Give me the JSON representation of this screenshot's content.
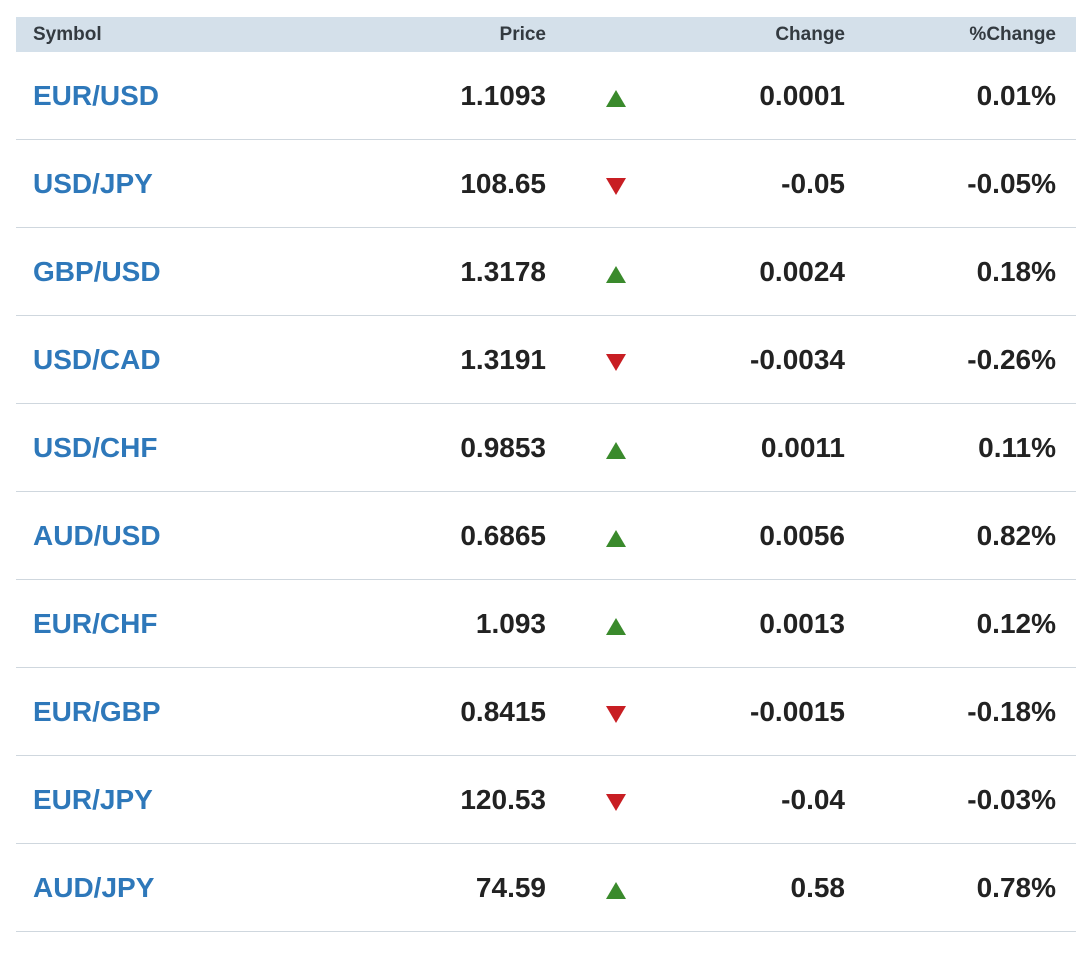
{
  "columns": {
    "symbol": "Symbol",
    "price": "Price",
    "change": "Change",
    "pct_change": "%Change"
  },
  "colors": {
    "up": "#3a8a2c",
    "down": "#c81e23",
    "link": "#2e78ba",
    "header_bg": "#d4e0ea"
  },
  "rows": [
    {
      "symbol": "EUR/USD",
      "price": "1.1093",
      "direction": "up",
      "change": "0.0001",
      "pct_change": "0.01%"
    },
    {
      "symbol": "USD/JPY",
      "price": "108.65",
      "direction": "down",
      "change": "-0.05",
      "pct_change": "-0.05%"
    },
    {
      "symbol": "GBP/USD",
      "price": "1.3178",
      "direction": "up",
      "change": "0.0024",
      "pct_change": "0.18%"
    },
    {
      "symbol": "USD/CAD",
      "price": "1.3191",
      "direction": "down",
      "change": "-0.0034",
      "pct_change": "-0.26%"
    },
    {
      "symbol": "USD/CHF",
      "price": "0.9853",
      "direction": "up",
      "change": "0.0011",
      "pct_change": "0.11%"
    },
    {
      "symbol": "AUD/USD",
      "price": "0.6865",
      "direction": "up",
      "change": "0.0056",
      "pct_change": "0.82%"
    },
    {
      "symbol": "EUR/CHF",
      "price": "1.093",
      "direction": "up",
      "change": "0.0013",
      "pct_change": "0.12%"
    },
    {
      "symbol": "EUR/GBP",
      "price": "0.8415",
      "direction": "down",
      "change": "-0.0015",
      "pct_change": "-0.18%"
    },
    {
      "symbol": "EUR/JPY",
      "price": "120.53",
      "direction": "down",
      "change": "-0.04",
      "pct_change": "-0.03%"
    },
    {
      "symbol": "AUD/JPY",
      "price": "74.59",
      "direction": "up",
      "change": "0.58",
      "pct_change": "0.78%"
    }
  ]
}
